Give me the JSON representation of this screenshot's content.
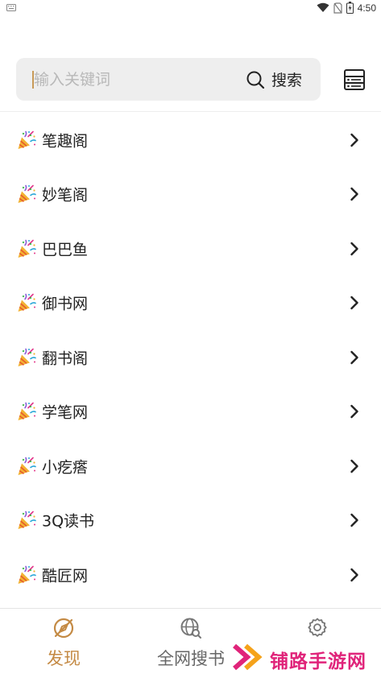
{
  "status_bar": {
    "time": "4:50"
  },
  "search": {
    "placeholder": "输入关键词",
    "button_label": "搜索"
  },
  "sources": [
    {
      "label": "笔趣阁"
    },
    {
      "label": "妙笔阁"
    },
    {
      "label": "巴巴鱼"
    },
    {
      "label": "御书网"
    },
    {
      "label": "翻书阁"
    },
    {
      "label": "学笔网"
    },
    {
      "label": "小疙瘩"
    },
    {
      "label": "3Q读书"
    },
    {
      "label": "酷匠网"
    }
  ],
  "icons": {
    "item": "party-popper-icon",
    "chevron": "chevron-right-icon",
    "search": "search-icon",
    "list": "list-view-icon"
  },
  "bottom_nav": {
    "tabs": [
      {
        "label": "发现",
        "icon": "compass-icon",
        "active": true
      },
      {
        "label": "全网搜书",
        "icon": "globe-search-icon",
        "active": false
      },
      {
        "label": "",
        "icon": "gear-icon",
        "active": false
      }
    ]
  },
  "watermark": {
    "text": "铺路手游网"
  },
  "colors": {
    "accent": "#c48a44",
    "search_bg": "#eeeeee",
    "watermark": "#e0247a"
  }
}
